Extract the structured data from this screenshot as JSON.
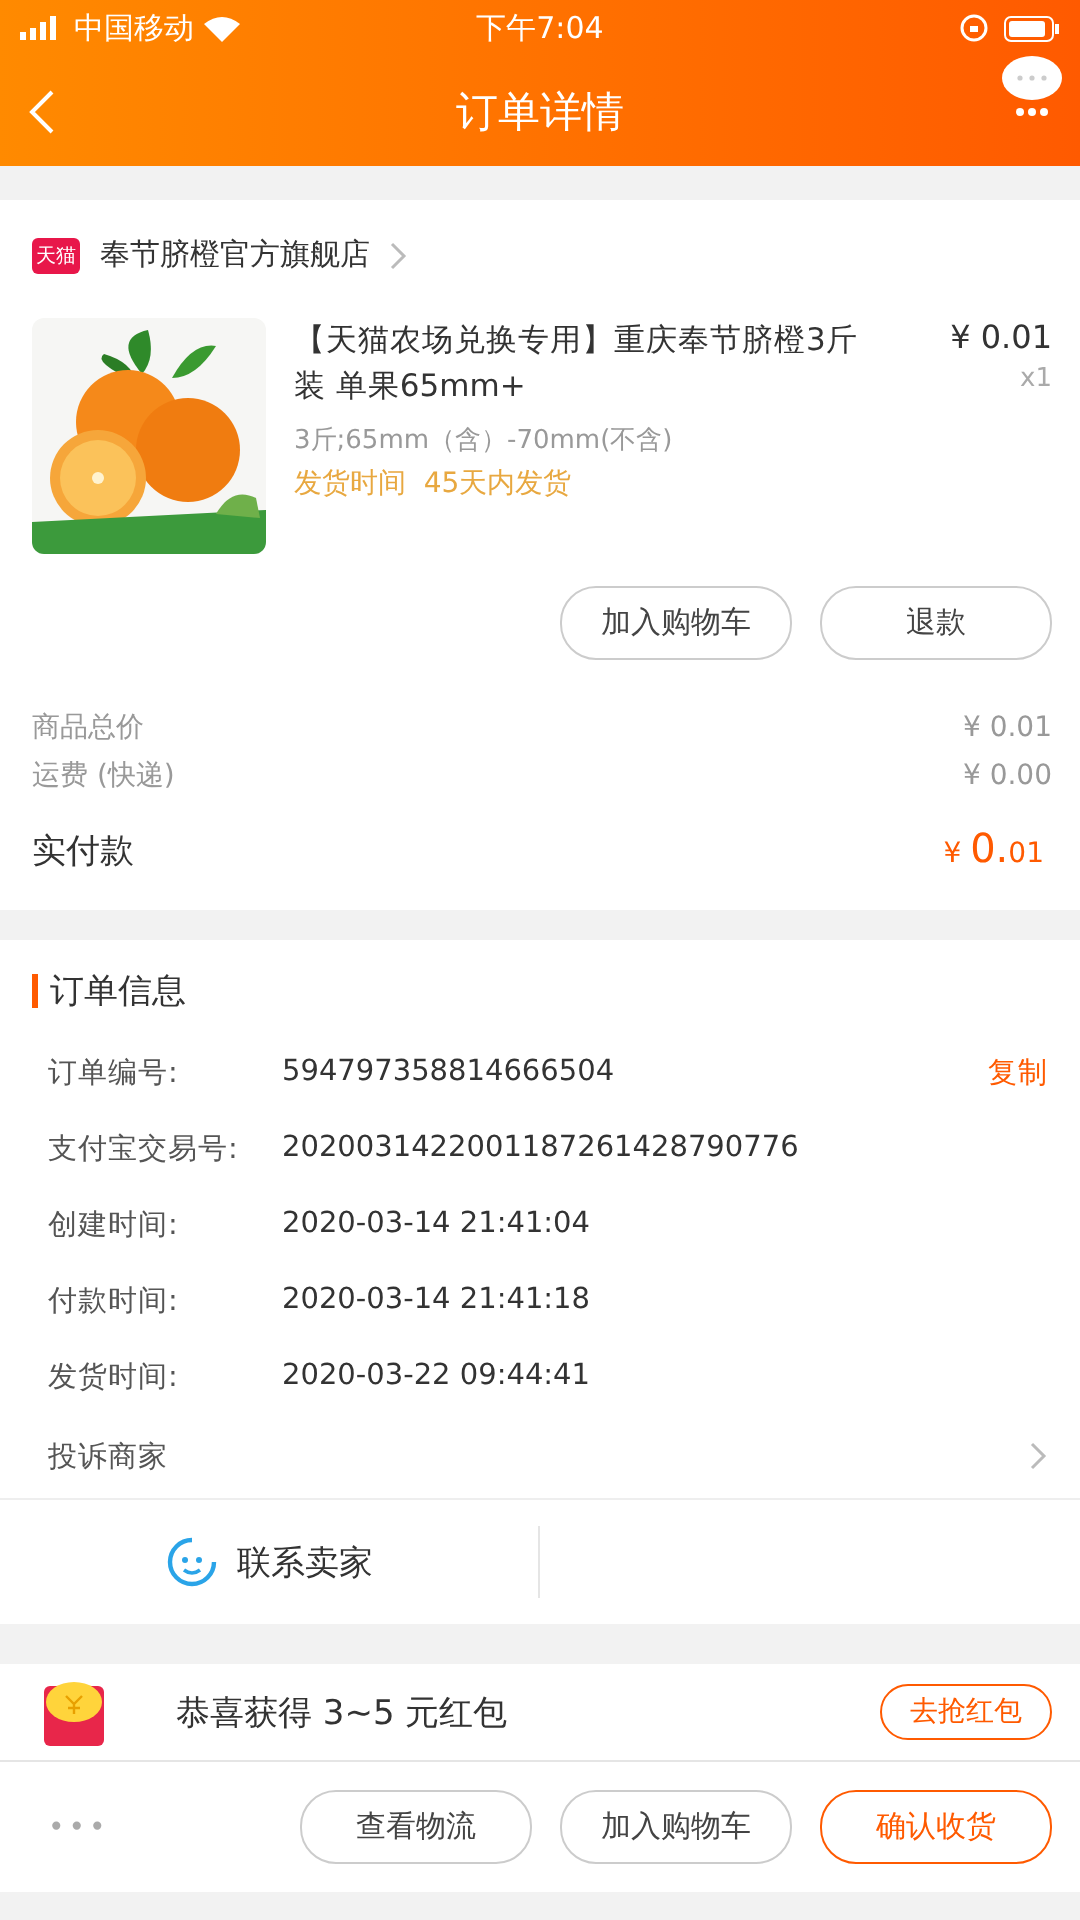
{
  "status_bar": {
    "carrier": "中国移动",
    "time": "下午7:04"
  },
  "nav": {
    "title": "订单详情"
  },
  "store": {
    "badge": "天猫",
    "name": "奉节脐橙官方旗舰店"
  },
  "product": {
    "image": {
      "kind": "picture"
    },
    "title": "【天猫农场兑换专用】重庆奉节脐橙3斤装 单果65mm+",
    "price": "¥ 0.01",
    "quantity": "x1",
    "spec": "3斤;65mm（含）-70mm(不含)",
    "shipping_note": "发货时间  45天内发货",
    "buttons": [
      "加入购物车",
      "退款"
    ]
  },
  "totals": [
    {
      "label": "商品总价",
      "value": "¥ 0.01"
    },
    {
      "label": "运费 (快递)",
      "value": "¥ 0.00"
    }
  ],
  "paid": {
    "label": "实付款",
    "currency": "¥",
    "integer": "0.",
    "decimal": "01"
  },
  "order_info": {
    "title": "订单信息",
    "rows": [
      {
        "label": "订单编号:",
        "value": "594797358814666504",
        "action": "复制"
      },
      {
        "label": "支付宝交易号:",
        "value": "2020031422001187261428790776"
      },
      {
        "label": "创建时间:",
        "value": "2020-03-14 21:41:04"
      },
      {
        "label": "付款时间:",
        "value": "2020-03-14 21:41:18"
      },
      {
        "label": "发货时间:",
        "value": "2020-03-22 09:44:41"
      }
    ],
    "complaint": "投诉商家",
    "contact": "联系卖家"
  },
  "red_packet": {
    "text": "恭喜获得 3~5 元红包",
    "button": "去抢红包"
  },
  "bottom_bar": {
    "more": "•••",
    "buttons": [
      {
        "label": "查看物流",
        "kind": "plain"
      },
      {
        "label": "加入购物车",
        "kind": "plain"
      },
      {
        "label": "确认收货",
        "kind": "primary"
      }
    ]
  }
}
